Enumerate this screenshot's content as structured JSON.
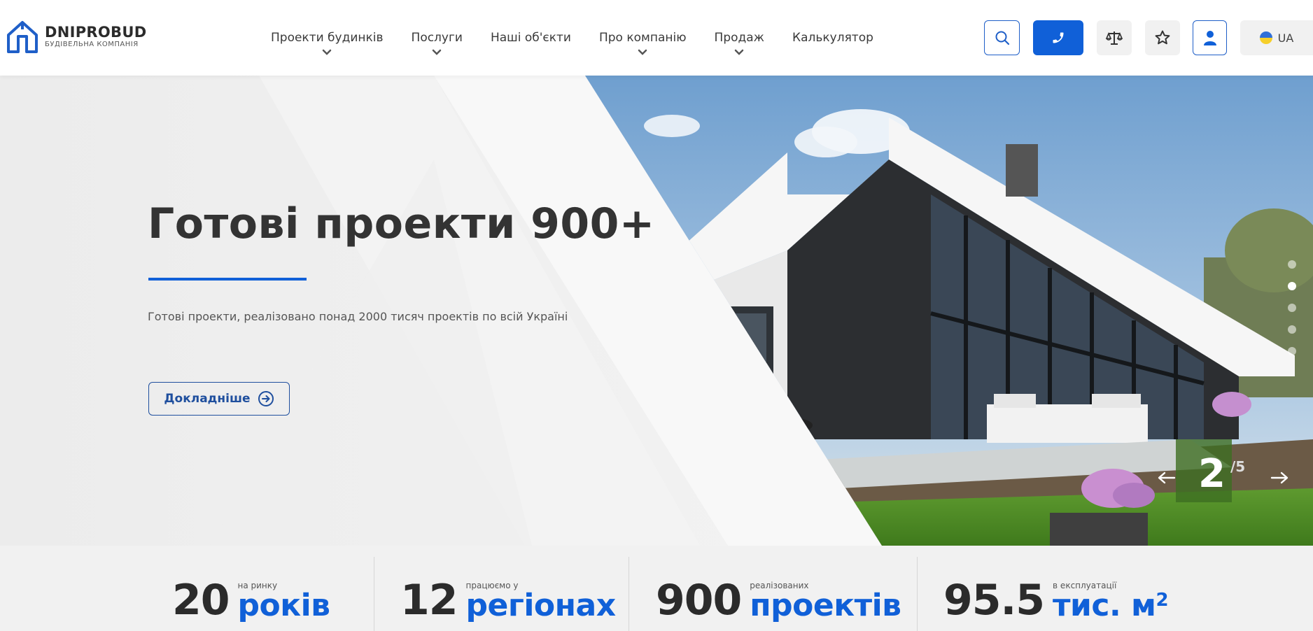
{
  "logo": {
    "name": "DNIPROBUD",
    "subtitle": "БУДІВЕЛЬНА КОМПАНІЯ"
  },
  "nav": {
    "items": [
      {
        "label": "Проекти будинків",
        "has_dropdown": true
      },
      {
        "label": "Послуги",
        "has_dropdown": true
      },
      {
        "label": "Наші об'єкти",
        "has_dropdown": false
      },
      {
        "label": "Про компанію",
        "has_dropdown": true
      },
      {
        "label": "Продаж",
        "has_dropdown": true
      },
      {
        "label": "Калькулятор",
        "has_dropdown": false
      }
    ]
  },
  "header_buttons": {
    "search_icon": "search-icon",
    "phone_icon": "phone-icon",
    "compare_icon": "scales-icon",
    "favorite_icon": "star-icon",
    "user_icon": "user-icon",
    "language": "UA"
  },
  "hero": {
    "title": "Готові проекти 900+",
    "description": "Готові проекти, реалізовано понад 2000 тисяч проектів по всій Україні",
    "button_label": "Докладніше",
    "current_slide": "2",
    "total_slides": "/5",
    "active_dot_index": 1,
    "dot_count": 5
  },
  "stats": [
    {
      "number": "20",
      "small": "на ринку",
      "big": "років"
    },
    {
      "number": "12",
      "small": "працюємо у",
      "big": "регіонах"
    },
    {
      "number": "900",
      "small": "реалізованих",
      "big": "проектів"
    },
    {
      "number": "95.5",
      "small": "в експлуатації",
      "big": "тис. м",
      "sup": "2"
    }
  ],
  "colors": {
    "accent": "#1060d8",
    "text_dark": "#2b2b2b",
    "background": "#f1f1f1"
  }
}
